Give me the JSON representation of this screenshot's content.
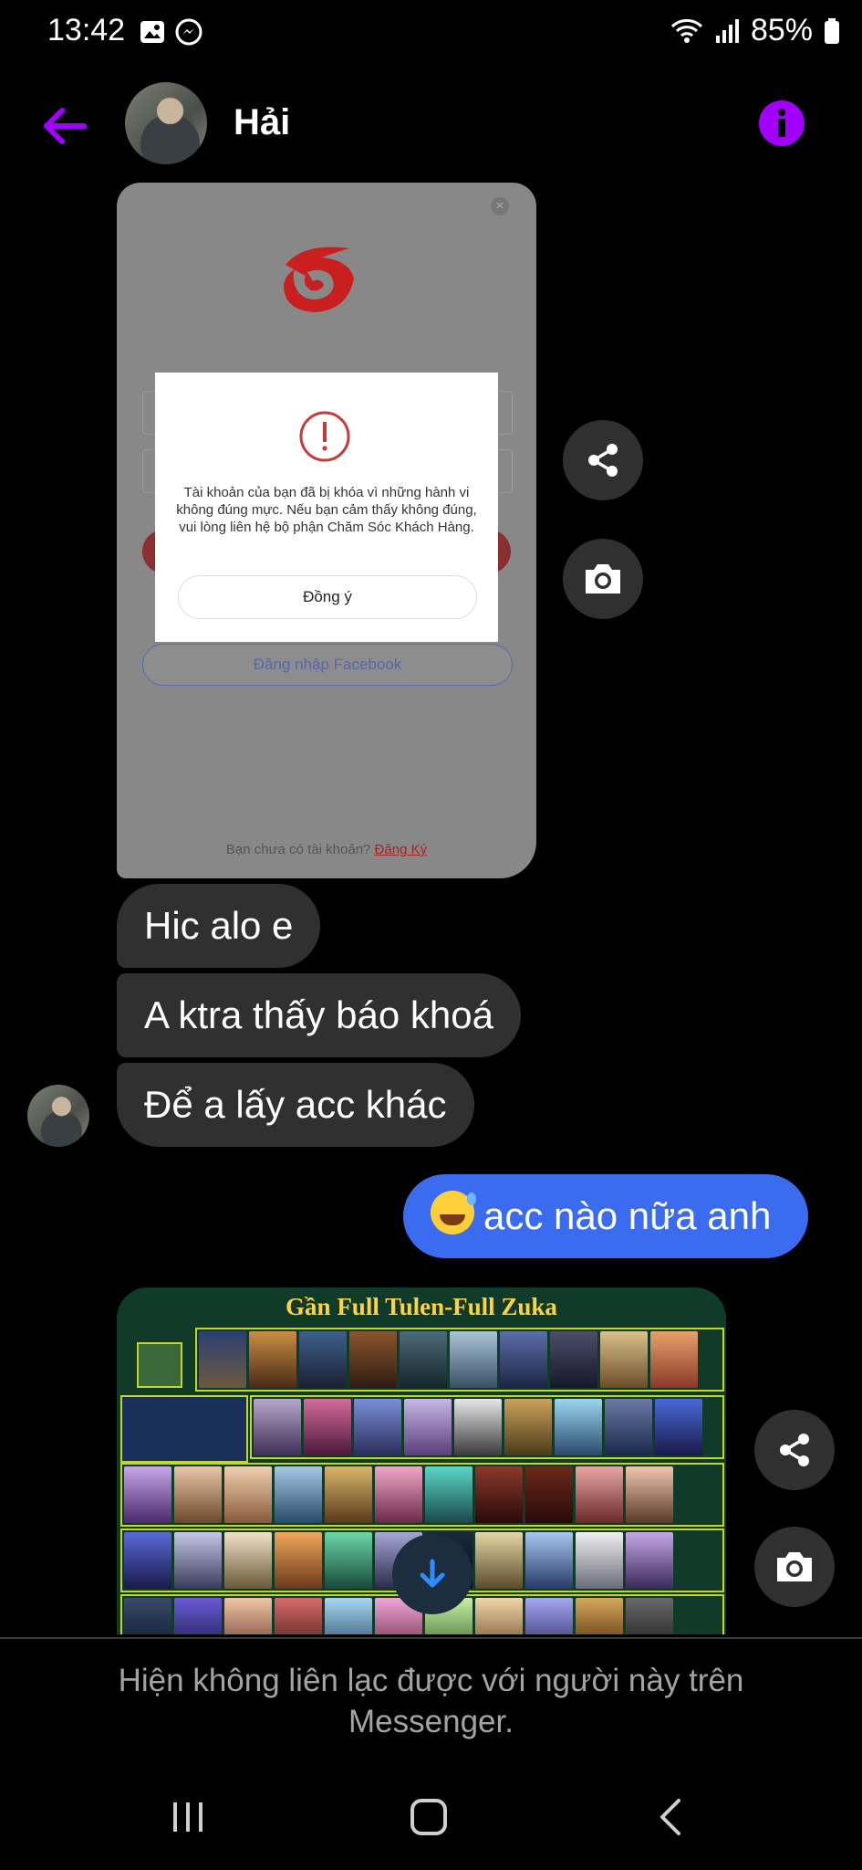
{
  "status_bar": {
    "time": "13:42",
    "battery": "85%",
    "left_icons": [
      "gallery-icon",
      "messenger-icon"
    ],
    "right_icons": [
      "wifi-icon",
      "signal-icon",
      "battery-icon"
    ]
  },
  "header": {
    "name": "Hải",
    "back_icon": "arrow-left-icon",
    "info_icon": "info-icon",
    "accent_color": "#a100ff"
  },
  "screenshot_message": {
    "dialog_text": "Tài khoản của bạn đã bị khóa vì những hành vi không đúng mực. Nếu bạn cảm thấy không đúng, vui lòng liên hệ bộ phận Chăm Sóc Khách Hàng.",
    "dialog_button": "Đồng ý",
    "facebook_login": "Đăng nhập Facebook",
    "register_prompt": "Bạn chưa có tài khoản?",
    "register_link": "Đăng Ký"
  },
  "messages": {
    "incoming": [
      "Hic alo e",
      "A ktra thấy báo khoá",
      "Để a lấy acc khác"
    ],
    "outgoing": "acc nào nữa anh",
    "outgoing_color": "#3b6cf0"
  },
  "game_image": {
    "title": "Gần Full Tulen-Full Zuka"
  },
  "actions": {
    "share_icon": "share-icon",
    "camera_icon": "camera-icon",
    "scroll_icon": "arrow-down-icon"
  },
  "footer": {
    "notice": "Hiện không liên lạc được với người này trên Messenger."
  },
  "nav": [
    "recents-icon",
    "home-icon",
    "back-icon"
  ]
}
